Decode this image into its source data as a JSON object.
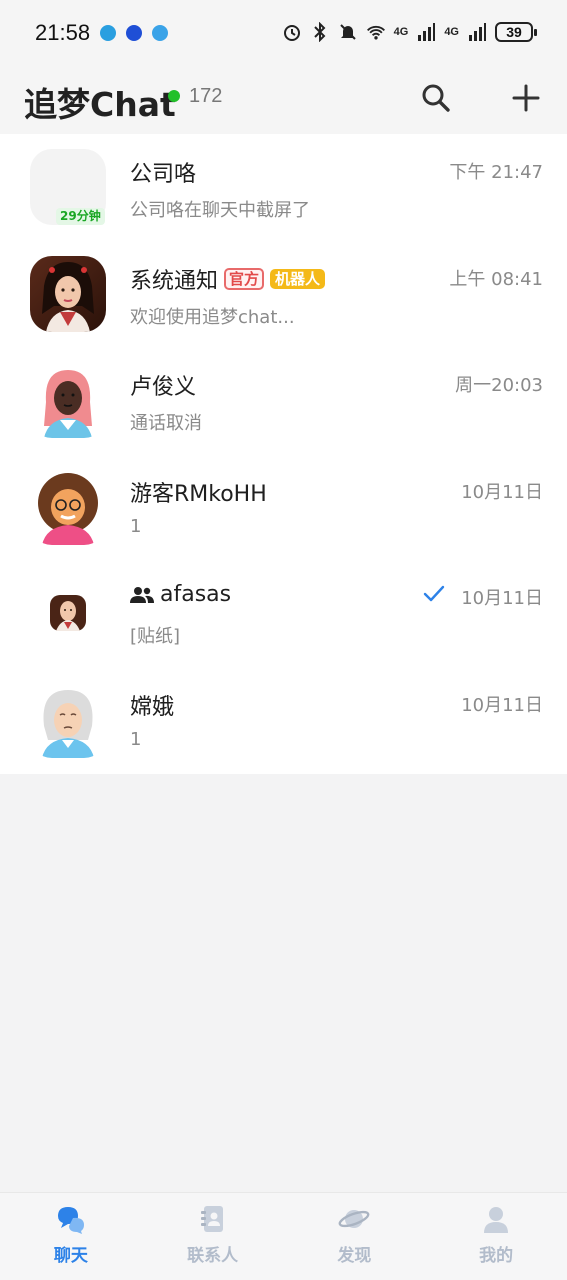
{
  "status_bar": {
    "time": "21:58",
    "battery": "39",
    "net1": "4G",
    "net2": "4G"
  },
  "header": {
    "title": "追梦Chat",
    "online_count": "172",
    "online_color": "#22c02a"
  },
  "chats": [
    {
      "name": "公司咯",
      "preview": "公司咯在聊天中截屏了",
      "time": "下午 21:47",
      "badge": "29分钟",
      "avatar": "blank"
    },
    {
      "name": "系统通知",
      "tag_official": "官方",
      "tag_robot": "机器人",
      "preview": "欢迎使用追梦chat...",
      "time": "上午 08:41",
      "avatar": "girl-photo"
    },
    {
      "name": "卢俊义",
      "preview": "通话取消",
      "time": "周一20:03",
      "avatar": "pink-hair-avatar"
    },
    {
      "name": "游客RMkoHH",
      "preview": "1",
      "time": "10月11日",
      "avatar": "curly-hair-avatar"
    },
    {
      "name": "afasas",
      "preview": "[贴纸]",
      "time": "10月11日",
      "avatar": "group-photo-avatar",
      "read": true
    },
    {
      "name": "嫦娥",
      "preview": "1",
      "time": "10月11日",
      "avatar": "grandma-avatar"
    }
  ],
  "tabs": [
    {
      "label": "聊天",
      "icon": "chat-bubbles-icon",
      "active": true
    },
    {
      "label": "联系人",
      "icon": "contacts-book-icon"
    },
    {
      "label": "发现",
      "icon": "planet-icon"
    },
    {
      "label": "我的",
      "icon": "person-icon"
    }
  ],
  "colors": {
    "accent": "#2d82e8",
    "tag_official": "#e24a4a",
    "tag_robot": "#f4b918",
    "badge_green": "#1aa624"
  }
}
